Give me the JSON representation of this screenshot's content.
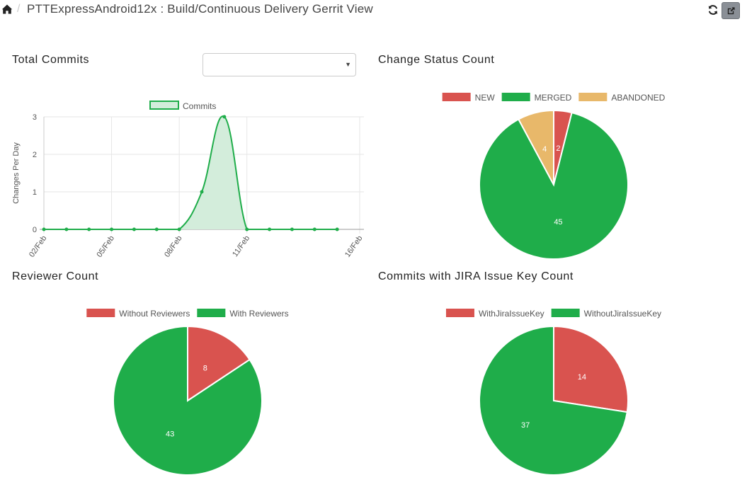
{
  "header": {
    "breadcrumb_separator": "/",
    "title": "PTTExpressAndroid12x : Build/Continuous Delivery Gerrit View",
    "home_icon": "home-icon",
    "refresh_icon": "refresh-icon",
    "popout_icon": "external-link-icon"
  },
  "panels": {
    "total_commits": {
      "title": "Total Commits",
      "select": {
        "value": ""
      }
    },
    "change_status": {
      "title": "Change Status Count"
    },
    "reviewer": {
      "title": "Reviewer Count"
    },
    "jira": {
      "title": "Commits with JIRA Issue Key Count"
    }
  },
  "colors": {
    "green": "#1fad4a",
    "red": "#d9534f",
    "orange": "#e8b86a",
    "fill_green": "#d3eddb",
    "grid": "#e6e6e6",
    "axis_text": "#555555"
  },
  "chart_data": [
    {
      "id": "total-commits",
      "type": "area",
      "legend": [
        "Commits"
      ],
      "legend_position": "top",
      "ylabel": "Changes Per Day",
      "ylim": [
        0,
        3
      ],
      "yticks": [
        "0",
        "1",
        "2",
        "3"
      ],
      "xticks": [
        "02/Feb",
        "05/Feb",
        "08/Feb",
        "11/Feb",
        "16/Feb"
      ],
      "xrange_days": [
        2,
        16
      ],
      "grid": true,
      "series": [
        {
          "name": "Commits",
          "points": [
            [
              2,
              0
            ],
            [
              3,
              0
            ],
            [
              4,
              0
            ],
            [
              5,
              0
            ],
            [
              6,
              0
            ],
            [
              7,
              0
            ],
            [
              8,
              0
            ],
            [
              9,
              1
            ],
            [
              10,
              3
            ],
            [
              11,
              0
            ],
            [
              12,
              0
            ],
            [
              13,
              0
            ],
            [
              14,
              0
            ],
            [
              15,
              0
            ]
          ]
        }
      ]
    },
    {
      "id": "change-status",
      "type": "pie",
      "legend_position": "top",
      "labels": [
        "NEW",
        "MERGED",
        "ABANDONED"
      ],
      "values": [
        2,
        45,
        4
      ],
      "colors": [
        "#d9534f",
        "#1fad4a",
        "#e8b86a"
      ]
    },
    {
      "id": "reviewer",
      "type": "pie",
      "legend_position": "top",
      "labels": [
        "Without Reviewers",
        "With Reviewers"
      ],
      "values": [
        8,
        43
      ],
      "colors": [
        "#d9534f",
        "#1fad4a"
      ]
    },
    {
      "id": "jira",
      "type": "pie",
      "legend_position": "top",
      "labels": [
        "WithJiraIssueKey",
        "WithoutJiraIssueKey"
      ],
      "values": [
        14,
        37
      ],
      "colors": [
        "#d9534f",
        "#1fad4a"
      ]
    }
  ]
}
